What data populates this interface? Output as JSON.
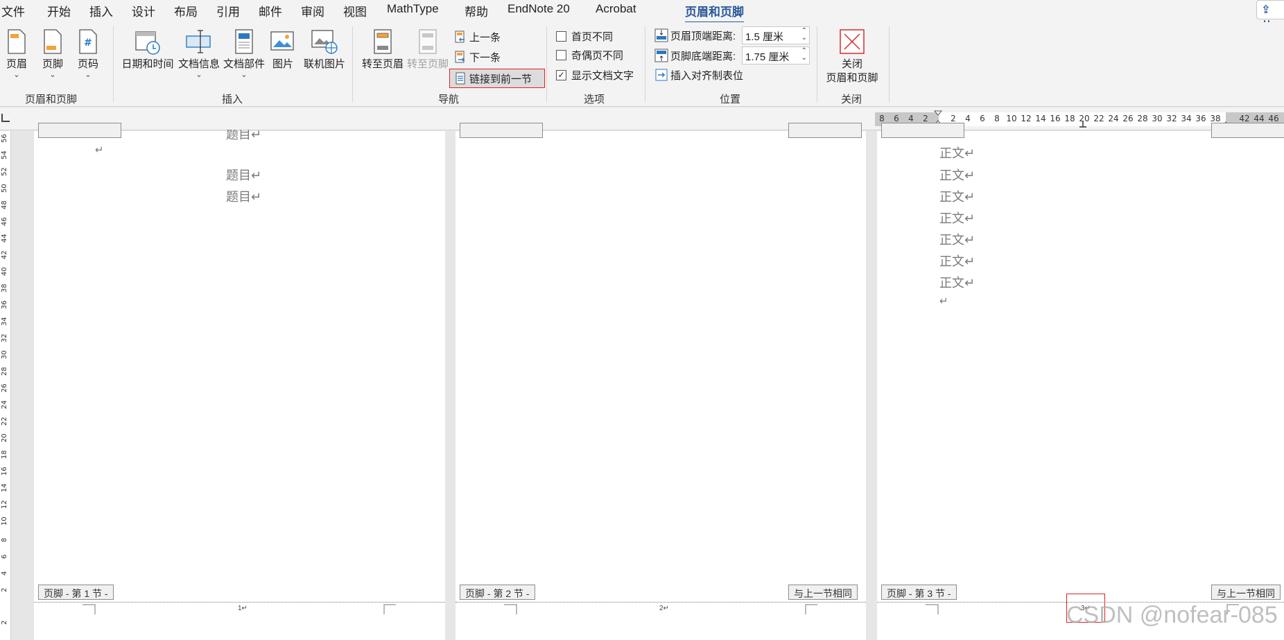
{
  "menu": {
    "tabs": [
      "文件",
      "开始",
      "插入",
      "设计",
      "布局",
      "引用",
      "邮件",
      "审阅",
      "视图",
      "MathType",
      "帮助",
      "EndNote 20",
      "Acrobat",
      "页眉和页脚"
    ],
    "active": "页眉和页脚",
    "share": "共"
  },
  "ribbon": {
    "groups": {
      "hf": "页眉和页脚",
      "insert": "插入",
      "nav": "导航",
      "options": "选项",
      "position": "位置",
      "close": "关闭"
    },
    "buttons": {
      "header": "页眉",
      "footer": "页脚",
      "page_number": "页码",
      "datetime": "日期和时间",
      "docinfo": "文档信息",
      "docparts": "文档部件",
      "picture": "图片",
      "online_picture": "联机图片",
      "goto_header": "转至页眉",
      "goto_footer": "转至页脚",
      "previous": "上一条",
      "next": "下一条",
      "link_previous": "链接到前一节",
      "close_line1": "关闭",
      "close_line2": "页眉和页脚"
    },
    "options": {
      "diff_first": "首页不同",
      "diff_odd_even": "奇偶页不同",
      "show_doc_text": "显示文档文字",
      "diff_first_checked": false,
      "diff_odd_even_checked": false,
      "show_doc_text_checked": true
    },
    "position": {
      "header_top_label": "页眉顶端距离:",
      "header_top_value": "1.5 厘米",
      "footer_bottom_label": "页脚底端距离:",
      "footer_bottom_value": "1.75 厘米",
      "insert_align_tab": "插入对齐制表位"
    }
  },
  "ruler": {
    "h_ticks": [
      "8",
      "6",
      "4",
      "2",
      "2",
      "4",
      "6",
      "8",
      "10",
      "12",
      "14",
      "16",
      "18",
      "20",
      "22",
      "24",
      "26",
      "28",
      "30",
      "32",
      "34",
      "36",
      "38",
      "42",
      "44",
      "46"
    ],
    "v_ticks": [
      "56",
      "54",
      "52",
      "50",
      "48",
      "46",
      "44",
      "42",
      "40",
      "38",
      "36",
      "34",
      "32",
      "30",
      "28",
      "26",
      "24",
      "22",
      "20",
      "18",
      "16",
      "14",
      "12",
      "10",
      "8",
      "6",
      "4",
      "2",
      "2"
    ]
  },
  "pages": [
    {
      "footer_tag": "页脚 - 第 1 节 -",
      "lines": [
        "题目↵",
        "题目↵"
      ],
      "cut_line": "题目↵",
      "page_number": "1↵"
    },
    {
      "footer_tag": "页脚 - 第 2 节 -",
      "same_as_prev": "与上一节相同",
      "page_number": "2↵"
    },
    {
      "footer_tag": "页脚 - 第 3 节 -",
      "same_as_prev": "与上一节相同",
      "lines": [
        "正文↵",
        "正文↵",
        "正文↵",
        "正文↵",
        "正文↵",
        "正文↵",
        "正文↵"
      ],
      "page_number": "3↵"
    }
  ],
  "para_mark": "↵",
  "watermark": "CSDN @nofear-085",
  "colors": {
    "accent": "#2b579a",
    "highlight_red": "#e02020"
  }
}
